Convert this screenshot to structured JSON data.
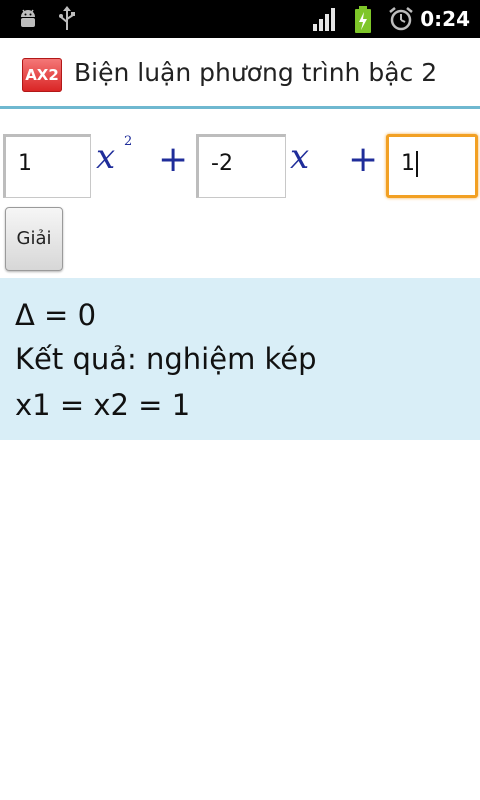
{
  "status_bar": {
    "time": "0:24",
    "icons": [
      "android-debug-icon",
      "usb-icon",
      "signal-icon",
      "battery-charging-icon",
      "alarm-icon"
    ]
  },
  "app": {
    "icon_label": "AX2",
    "title": "Biện luận phương trình bậc 2",
    "accent_color": "#6fb8d0"
  },
  "equation": {
    "a_value": "1",
    "x_squared_symbol": "x",
    "exponent": "2",
    "plus_1": "+",
    "b_value": "-2",
    "x_symbol": "x",
    "plus_2": "+",
    "c_value": "1"
  },
  "solve_button": {
    "label": "Giải"
  },
  "result": {
    "delta_line": "Δ = 0",
    "result_line": "Kết quả: nghiệm kép",
    "roots_line": "x1 = x2 = 1"
  },
  "colors": {
    "focus": "#f2a023",
    "math": "#1f2d9a",
    "result_bg": "#d9eef7"
  }
}
